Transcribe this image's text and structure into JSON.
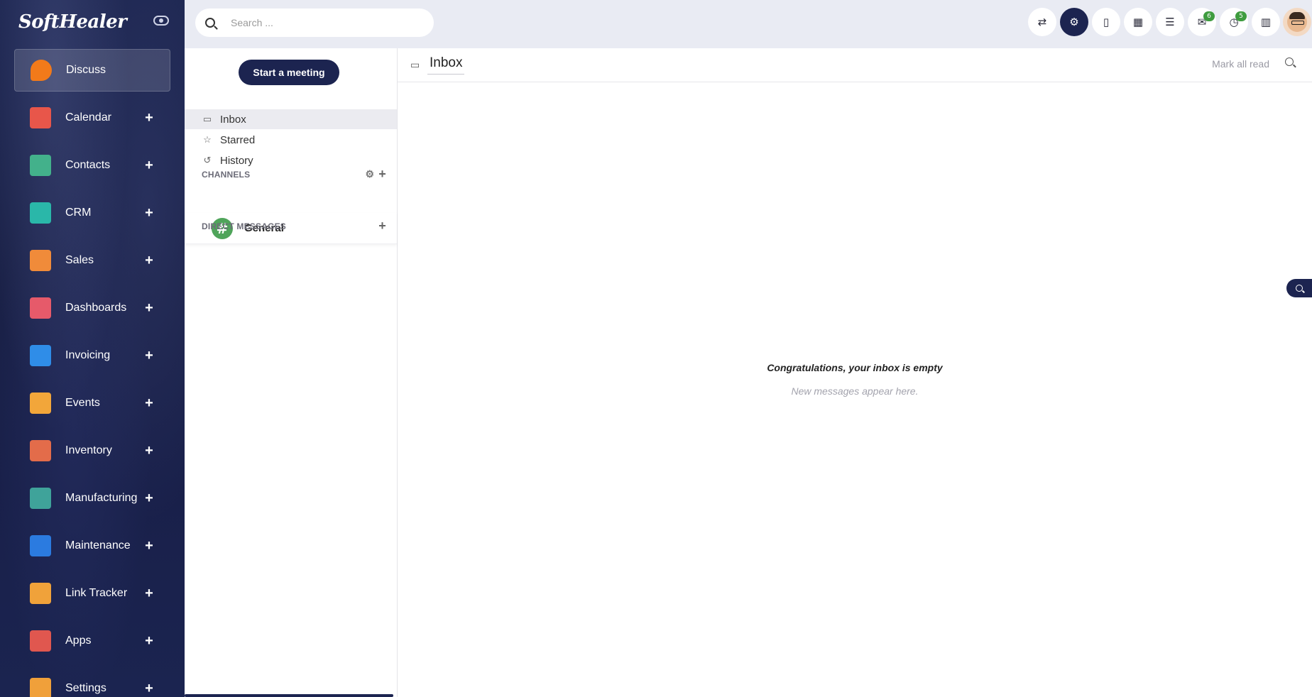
{
  "brand": "SoftHealer",
  "apps": [
    {
      "label": "Discuss",
      "active": true,
      "icon": "discuss-icon",
      "color": "#f27a1a",
      "plus": ""
    },
    {
      "label": "Calendar",
      "active": false,
      "icon": "calendar-icon",
      "color": "#e8564a",
      "plus": "+"
    },
    {
      "label": "Contacts",
      "active": false,
      "icon": "contacts-icon",
      "color": "#43b18b",
      "plus": "+"
    },
    {
      "label": "CRM",
      "active": false,
      "icon": "crm-icon",
      "color": "#2ab7a9",
      "plus": "+"
    },
    {
      "label": "Sales",
      "active": false,
      "icon": "sales-icon",
      "color": "#f08b3a",
      "plus": "+"
    },
    {
      "label": "Dashboards",
      "active": false,
      "icon": "dashboards-icon",
      "color": "#e65a6a",
      "plus": "+"
    },
    {
      "label": "Invoicing",
      "active": false,
      "icon": "invoicing-icon",
      "color": "#2f8de8",
      "plus": "+"
    },
    {
      "label": "Events",
      "active": false,
      "icon": "events-icon",
      "color": "#f2a63a",
      "plus": "+"
    },
    {
      "label": "Inventory",
      "active": false,
      "icon": "inventory-icon",
      "color": "#e36c4a",
      "plus": "+"
    },
    {
      "label": "Manufacturing",
      "active": false,
      "icon": "manufacturing-icon",
      "color": "#3fa39a",
      "plus": "+"
    },
    {
      "label": "Maintenance",
      "active": false,
      "icon": "maintenance-icon",
      "color": "#2b7be0",
      "plus": "+"
    },
    {
      "label": "Link Tracker",
      "active": false,
      "icon": "link-tracker-icon",
      "color": "#f0a23a",
      "plus": "+"
    },
    {
      "label": "Apps",
      "active": false,
      "icon": "apps-icon",
      "color": "#e0574f",
      "plus": "+"
    },
    {
      "label": "Settings",
      "active": false,
      "icon": "settings-icon",
      "color": "#f0a03a",
      "plus": "+"
    }
  ],
  "search": {
    "placeholder": "Search ..."
  },
  "systray": [
    {
      "icon": "translate-icon",
      "glyph": "⇄",
      "badge": "",
      "dark": false
    },
    {
      "icon": "gear-icon",
      "glyph": "⚙",
      "badge": "",
      "dark": true
    },
    {
      "icon": "bookmark-icon",
      "glyph": "▯",
      "badge": "",
      "dark": false
    },
    {
      "icon": "calculator-icon",
      "glyph": "▦",
      "badge": "",
      "dark": false
    },
    {
      "icon": "list-toggle-icon",
      "glyph": "☰",
      "badge": "",
      "dark": false
    },
    {
      "icon": "chat-icon",
      "glyph": "✉",
      "badge": "6",
      "dark": false
    },
    {
      "icon": "activity-clock-icon",
      "glyph": "◷",
      "badge": "5",
      "dark": false
    },
    {
      "icon": "building-icon",
      "glyph": "▥",
      "badge": "",
      "dark": false
    }
  ],
  "discuss": {
    "start_meeting": "Start a meeting",
    "mailboxes": [
      {
        "label": "Inbox",
        "icon": "inbox-icon",
        "glyph": "▭",
        "active": true
      },
      {
        "label": "Starred",
        "icon": "star-icon",
        "glyph": "☆",
        "active": false
      },
      {
        "label": "History",
        "icon": "history-icon",
        "glyph": "↺",
        "active": false
      }
    ],
    "channels_label": "CHANNELS",
    "channels": [
      {
        "name": "General",
        "avatar": "#"
      }
    ],
    "direct_messages_label": "DIRECT MESSAGES"
  },
  "thread": {
    "title": "Inbox",
    "mark_all_read": "Mark all read",
    "empty_title": "Congratulations, your inbox is empty",
    "empty_subtitle": "New messages appear here."
  }
}
